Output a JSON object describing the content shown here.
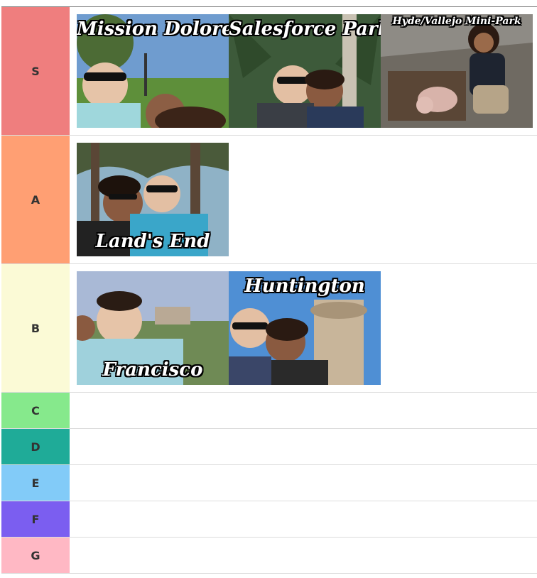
{
  "tiers": [
    {
      "label": "S",
      "color": "#ef7e7e",
      "items": [
        {
          "caption": "Mission Dolores",
          "icon": "photo-couple-selfie-park"
        },
        {
          "caption": "Salesforce Park",
          "icon": "photo-couple-selfie-palms"
        },
        {
          "caption": "Hyde/Vallejo Mini-Park",
          "icon": "photo-woman-pig-statue"
        }
      ]
    },
    {
      "label": "A",
      "color": "#ff9f73",
      "items": [
        {
          "caption": "Land's End",
          "icon": "photo-couple-selfie-cypress"
        }
      ]
    },
    {
      "label": "B",
      "color": "#fbfad6",
      "items": [
        {
          "caption": "Francisco",
          "icon": "photo-couple-selfie-hillside"
        },
        {
          "caption": "Huntington",
          "icon": "photo-couple-selfie-fountain"
        }
      ]
    },
    {
      "label": "C",
      "color": "#86e98c",
      "items": []
    },
    {
      "label": "D",
      "color": "#1fab98",
      "items": []
    },
    {
      "label": "E",
      "color": "#82cbf8",
      "items": []
    },
    {
      "label": "F",
      "color": "#7b5ef0",
      "items": []
    },
    {
      "label": "G",
      "color": "#ffb8c4",
      "items": []
    }
  ]
}
